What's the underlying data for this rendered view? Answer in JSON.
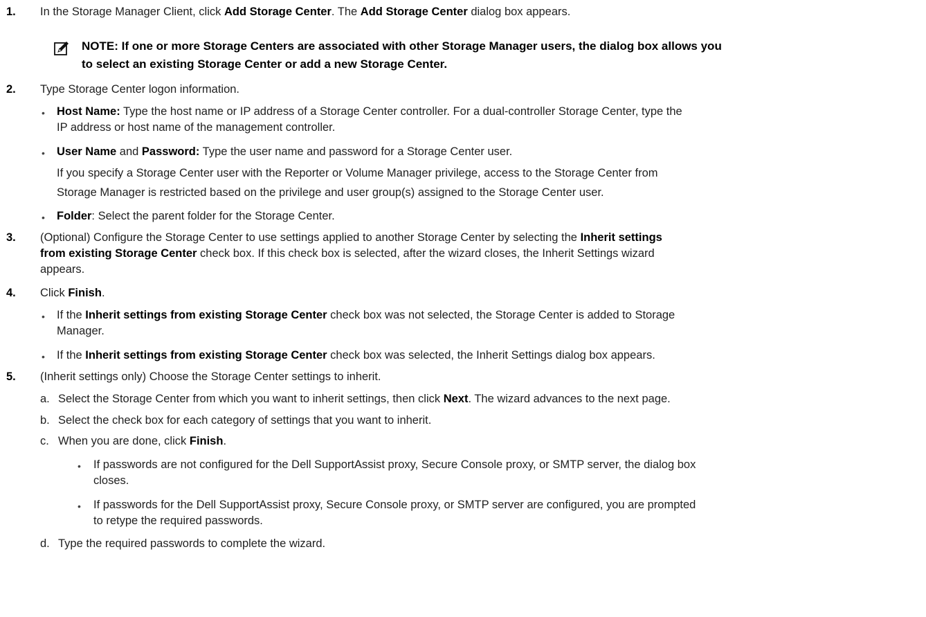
{
  "steps": {
    "s1": {
      "num": "1.",
      "pre": "In the Storage Manager Client, click ",
      "b1": "Add Storage Center",
      "mid": ". The ",
      "b2": "Add Storage Center",
      "post": " dialog box appears."
    },
    "note": {
      "line1": "NOTE: If one or more Storage Centers are associated with other Storage Manager users, the dialog box allows you",
      "line2": "to select an existing Storage Center or add a new Storage Center."
    },
    "s2": {
      "num": "2.",
      "text": "Type Storage Center logon information.",
      "host_b": "Host Name:",
      "host_l1": " Type the host name or IP address of a Storage Center controller. For a dual-controller Storage Center, type the",
      "host_l2": "IP address or host name of the management controller.",
      "user_b1": "User Name",
      "user_and": " and ",
      "user_b2": "Password:",
      "user_text": " Type the user name and password for a Storage Center user.",
      "user_p1": "If you specify a Storage Center user with the Reporter or Volume Manager privilege, access to the Storage Center from",
      "user_p2": "Storage Manager is restricted based on the privilege and user group(s) assigned to the Storage Center user.",
      "folder_b": "Folder",
      "folder_text": ": Select the parent folder for the Storage Center."
    },
    "s3": {
      "num": "3.",
      "l1_pre": "(Optional) Configure the Storage Center to use settings applied to another Storage Center by selecting the ",
      "l1_b": "Inherit settings",
      "l2_b": "from existing Storage Center",
      "l2_post": " check box. If this check box is selected, after the wizard closes, the Inherit Settings wizard",
      "l3": "appears."
    },
    "s4": {
      "num": "4.",
      "pre": "Click ",
      "b": "Finish",
      "post": ".",
      "b1_pre": "If the ",
      "b1_b": "Inherit settings from existing Storage Center",
      "b1_post": " check box was not selected, the Storage Center is added to Storage",
      "b1_l2": "Manager.",
      "b2_pre": "If the ",
      "b2_b": "Inherit settings from existing Storage Center",
      "b2_post": " check box was selected, the Inherit Settings dialog box appears."
    },
    "s5": {
      "num": "5.",
      "text": "(Inherit settings only) Choose the Storage Center settings to inherit.",
      "a_let": "a.",
      "a_pre": "Select the Storage Center from which you want to inherit settings, then click ",
      "a_b": "Next",
      "a_post": ". The wizard advances to the next page.",
      "b_let": "b.",
      "b_text": "Select the check box for each category of settings that you want to inherit.",
      "c_let": "c.",
      "c_pre": "When you are done, click ",
      "c_b": "Finish",
      "c_post": ".",
      "c1_l1": "If passwords are not configured for the Dell SupportAssist proxy, Secure Console proxy, or SMTP server, the dialog box",
      "c1_l2": "closes.",
      "c2_l1": "If passwords for the Dell SupportAssist proxy, Secure Console proxy, or SMTP server are configured, you are prompted",
      "c2_l2": "to retype the required passwords.",
      "d_let": "d.",
      "d_text": "Type the required passwords to complete the wizard."
    },
    "bullet": "•",
    "note_icon": "pencil-icon"
  }
}
